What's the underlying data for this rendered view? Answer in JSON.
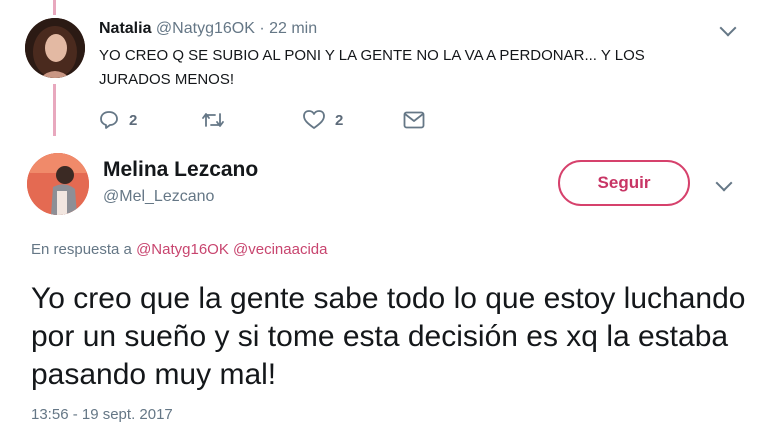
{
  "tweet1": {
    "author_name": "Natalia",
    "handle": "@Natyg16OK",
    "separator": "·",
    "time": "22 min",
    "text": "YO CREO Q SE SUBIO AL PONI Y LA GENTE NO LA VA A PERDONAR... Y LOS JURADOS MENOS!",
    "actions": {
      "reply_icon": "reply-icon",
      "reply_count": "2",
      "retweet_icon": "retweet-icon",
      "like_icon": "heart-icon",
      "like_count": "2",
      "dm_icon": "envelope-icon"
    }
  },
  "tweet2": {
    "author_name": "Melina Lezcano",
    "handle": "@Mel_Lezcano",
    "follow_label": "Seguir",
    "reply_prefix": "En respuesta a",
    "mention1": "@Natyg16OK",
    "mention2": "@vecinaacida",
    "text": "Yo creo que la gente sabe todo lo que estoy luchando por un sueño y si tome esta decisión es xq la estaba pasando muy mal!",
    "timestamp": "13:56 - 19 sept. 2017"
  },
  "colors": {
    "accent": "#c83565",
    "thread_line": "#e8a8be",
    "secondary_text": "#657786"
  }
}
